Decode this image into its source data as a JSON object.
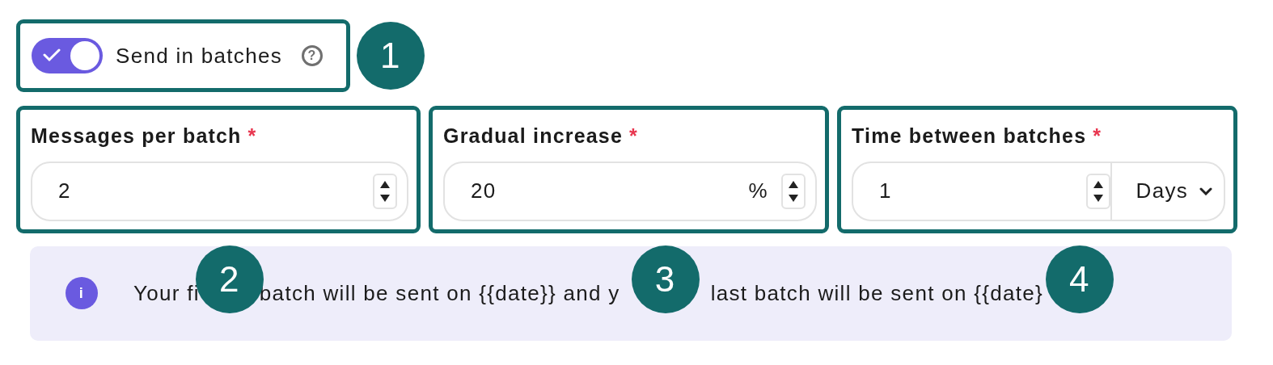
{
  "toggle": {
    "label": "Send in batches",
    "on": true,
    "help_icon": "?",
    "callout": "1"
  },
  "fields": [
    {
      "kind": "number",
      "label": "Messages per batch",
      "required_mark": "*",
      "value": "2",
      "callout": "2"
    },
    {
      "kind": "number",
      "label": "Gradual increase",
      "required_mark": "*",
      "value": "20",
      "suffix": "%",
      "callout": "3"
    },
    {
      "kind": "number_unit",
      "label": "Time between batches",
      "required_mark": "*",
      "value": "1",
      "unit": "Days",
      "callout": "4"
    }
  ],
  "info": {
    "icon": "i",
    "fragments": [
      "Your fi",
      "batch will be sent on {{date}} and y",
      "last batch will be sent on {{date}"
    ]
  }
}
